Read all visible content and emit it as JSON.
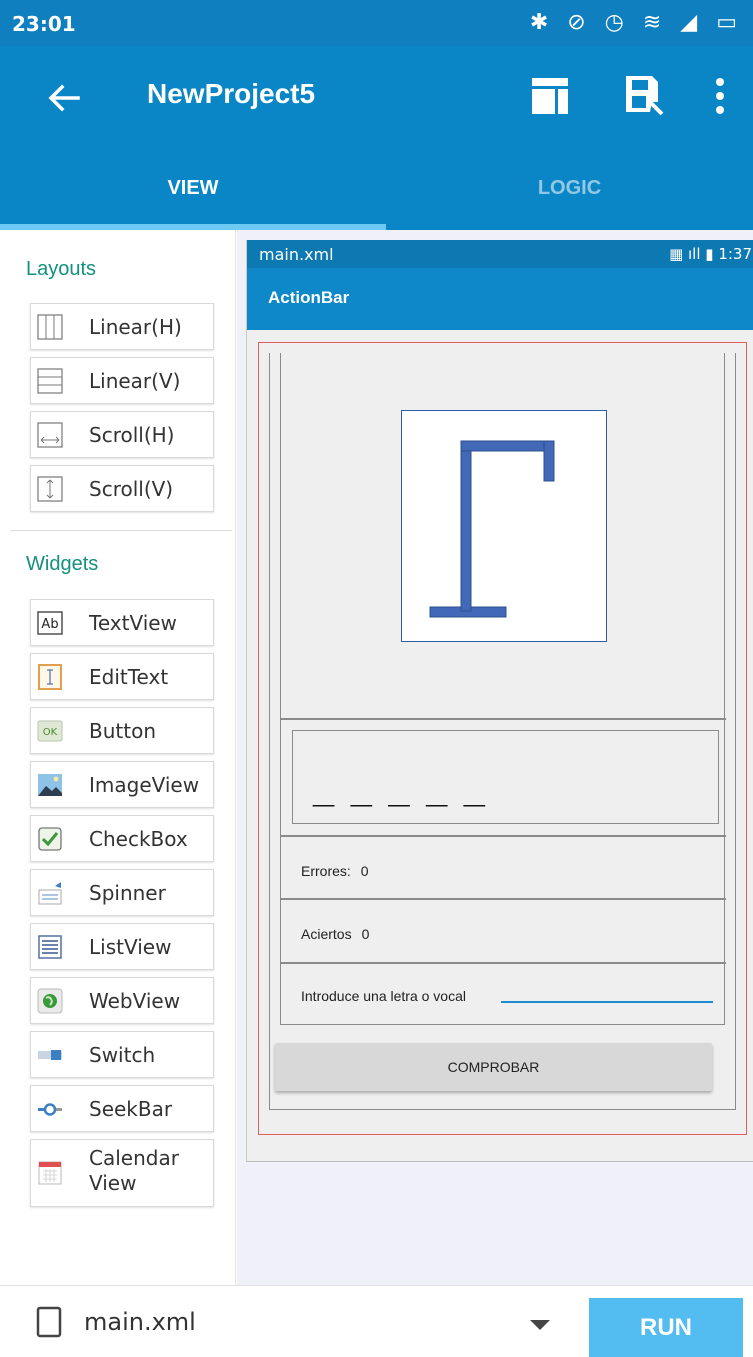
{
  "status_bar": {
    "time": "23:01",
    "icons": "✱ ⊘ ◷ ≋ ◢ ▭"
  },
  "app_bar": {
    "title": "NewProject5",
    "tabs": [
      {
        "label": "VIEW",
        "active": true
      },
      {
        "label": "LOGIC",
        "active": false
      }
    ],
    "accent_color": "#0a86c6"
  },
  "palette": {
    "layouts_title": "Layouts",
    "layouts": [
      {
        "label": "Linear(H)",
        "icon": "linear-horizontal-icon"
      },
      {
        "label": "Linear(V)",
        "icon": "linear-vertical-icon"
      },
      {
        "label": "Scroll(H)",
        "icon": "scroll-horizontal-icon"
      },
      {
        "label": "Scroll(V)",
        "icon": "scroll-vertical-icon"
      }
    ],
    "widgets_title": "Widgets",
    "widgets": [
      {
        "label": "TextView",
        "icon": "textview-icon"
      },
      {
        "label": "EditText",
        "icon": "edittext-icon"
      },
      {
        "label": "Button",
        "icon": "button-icon"
      },
      {
        "label": "ImageView",
        "icon": "imageview-icon"
      },
      {
        "label": "CheckBox",
        "icon": "checkbox-icon"
      },
      {
        "label": "Spinner",
        "icon": "spinner-icon"
      },
      {
        "label": "ListView",
        "icon": "listview-icon"
      },
      {
        "label": "WebView",
        "icon": "webview-icon"
      },
      {
        "label": "Switch",
        "icon": "switch-icon"
      },
      {
        "label": "SeekBar",
        "icon": "seekbar-icon"
      },
      {
        "label_line1": "Calendar",
        "label_line2": "View",
        "icon": "calendarview-icon"
      }
    ]
  },
  "preview": {
    "file_name": "main.xml",
    "status_time": "1:37",
    "status_icons": "▦ ıll ▮",
    "action_bar_title": "ActionBar",
    "hidden_word": "_ _ _ _ _",
    "errores_label": "Errores:",
    "errores_value": "0",
    "aciertos_label": "Aciertos",
    "aciertos_value": "0",
    "input_label": "Introduce una letra o vocal",
    "button_label": "COMPROBAR"
  },
  "bottom_bar": {
    "file_name": "main.xml",
    "run_label": "RUN"
  }
}
